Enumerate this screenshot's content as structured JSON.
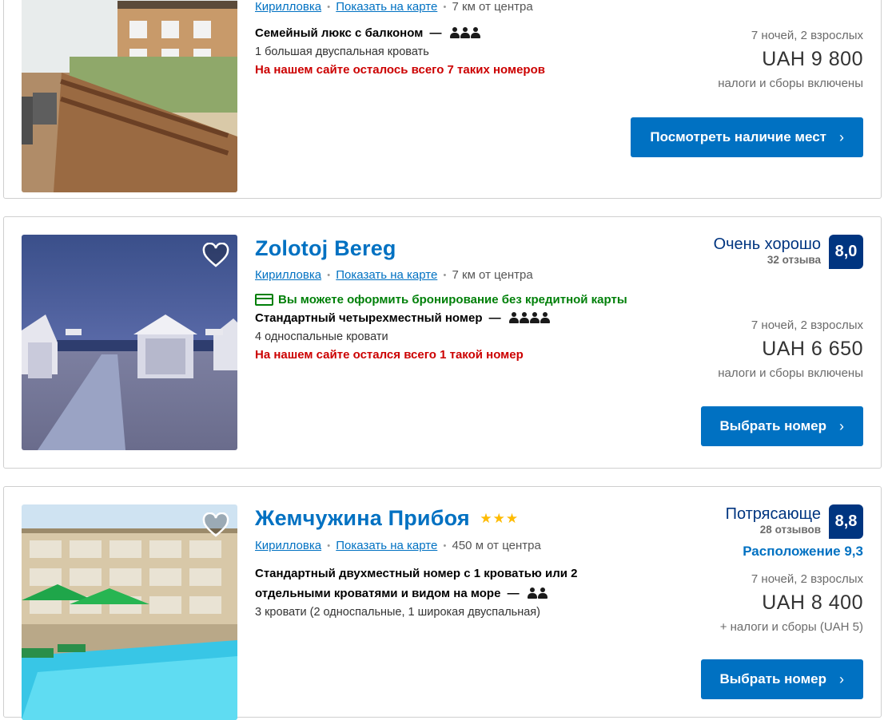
{
  "listings": [
    {
      "name": "",
      "stars": "",
      "city_link": "Кирилловка",
      "map_link": "Показать на карте",
      "distance": "7 км от центра",
      "room_name": "Семейный люкс с балконом",
      "room_dash": "—",
      "guests": 3,
      "beds": "1 большая двуспальная кровать",
      "scarcity": "На нашем сайте осталось всего 7 таких номеров",
      "stay": "7 ночей, 2 взрослых",
      "price": "UAH 9 800",
      "taxes": "налоги и сборы включены",
      "button": "Посмотреть наличие мест",
      "button_chevron": "›"
    },
    {
      "name": "Zolotoj Bereg",
      "city_link": "Кирилловка",
      "map_link": "Показать на карте",
      "distance": "7 км от центра",
      "no_card": "Вы можете оформить бронирование без кредитной карты",
      "room_name": "Стандартный четырехместный номер",
      "room_dash": "—",
      "guests": 4,
      "beds": "4 односпальные кровати",
      "scarcity": "На нашем сайте остался всего 1 такой номер",
      "score_word": "Очень хорошо",
      "reviews": "32 отзыва",
      "score": "8,0",
      "stay": "7 ночей, 2 взрослых",
      "price": "UAH 6 650",
      "taxes": "налоги и сборы включены",
      "button": "Выбрать номер",
      "button_chevron": "›"
    },
    {
      "name": "Жемчужина Прибоя",
      "stars": "★★★",
      "star_count": 3,
      "city_link": "Кирилловка",
      "map_link": "Показать на карте",
      "distance": "450 м от центра",
      "room_name": "Стандартный двухместный номер с 1 кроватью или 2 отдельными кроватями и видом на море",
      "room_dash": "—",
      "guests": 2,
      "beds": "3 кровати (2 односпальные, 1 широкая двуспальная)",
      "score_word": "Потрясающе",
      "reviews": "28 отзывов",
      "score": "8,8",
      "location_score": "Расположение 9,3",
      "stay": "7 ночей, 2 взрослых",
      "price": "UAH 8 400",
      "taxes": "+ налоги и сборы (UAH 5)",
      "button": "Выбрать номер",
      "button_chevron": "›"
    }
  ],
  "separator_dot": "•",
  "colors": {
    "brand_blue": "#0071c2",
    "dark_blue": "#003580",
    "green": "#008009",
    "red": "#cc0000",
    "star_yellow": "#febb02"
  },
  "icons": {
    "favorite": "heart-icon",
    "guest": "person-icon",
    "no_card": "credit-card-icon"
  }
}
